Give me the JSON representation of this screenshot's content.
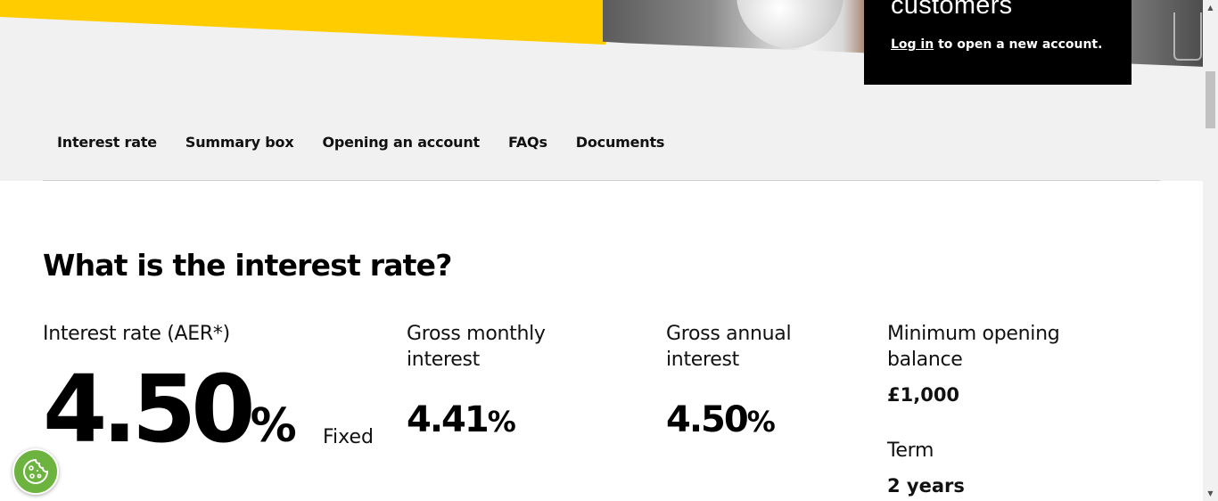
{
  "account_box": {
    "title": "customers",
    "login_link": "Log in",
    "login_suffix": " to open a new account."
  },
  "tabs": [
    {
      "label": "Interest rate"
    },
    {
      "label": "Summary box"
    },
    {
      "label": "Opening an account"
    },
    {
      "label": "FAQs"
    },
    {
      "label": "Documents"
    }
  ],
  "section": {
    "heading": "What is the interest rate?",
    "interest_rate": {
      "label": "Interest rate (AER*)",
      "value": "4.50",
      "unit": "%",
      "type": "Fixed"
    },
    "gross_monthly": {
      "label_line1": "Gross monthly",
      "label_line2": "interest",
      "value": "4.41",
      "unit": "%"
    },
    "gross_annual": {
      "label_line1": "Gross annual",
      "label_line2": "interest",
      "value": "4.50",
      "unit": "%"
    },
    "minimum_opening": {
      "label_line1": "Minimum opening",
      "label_line2": "balance",
      "value": "£1,000"
    },
    "term": {
      "label": "Term",
      "value": "2 years"
    }
  },
  "colors": {
    "accent": "#ffcc00",
    "cookie_button": "#6cb33f",
    "box_background": "#000000"
  },
  "icons": {
    "cookie_button": "cookie-icon",
    "scroll_up": "arrow-up-icon",
    "scroll_down": "arrow-down-icon"
  }
}
